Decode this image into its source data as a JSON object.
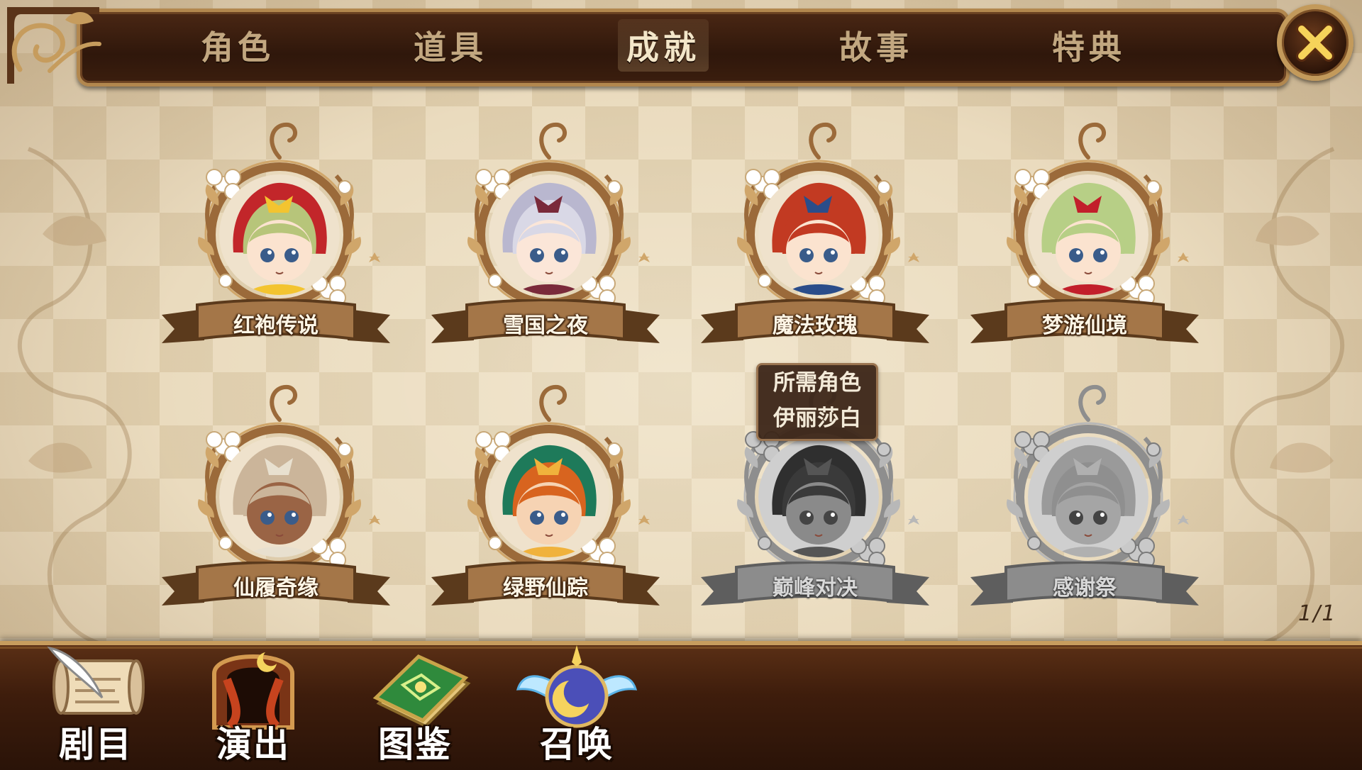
{
  "tabs": [
    {
      "label": "角色",
      "active": false
    },
    {
      "label": "道具",
      "active": false
    },
    {
      "label": "成就",
      "active": true
    },
    {
      "label": "故事",
      "active": false
    },
    {
      "label": "特典",
      "active": false
    }
  ],
  "close_icon": "close-x-icon",
  "cards": [
    {
      "title": "红袍传说",
      "locked": false,
      "hair": "#b7c57a",
      "hood": "#c2262a",
      "accent": "#f3c430",
      "skin": "#fbe3cf"
    },
    {
      "title": "雪国之夜",
      "locked": false,
      "hair": "#d9d8e6",
      "hood": "#b9b7cf",
      "accent": "#7a2a3a",
      "skin": "#fbe6d8"
    },
    {
      "title": "魔法玫瑰",
      "locked": false,
      "hair": "#c23a22",
      "hood": "#c23a22",
      "accent": "#2a4d8a",
      "skin": "#fbe3cf"
    },
    {
      "title": "梦游仙境",
      "locked": false,
      "hair": "#b7cf86",
      "hood": "#b7cf86",
      "accent": "#c21f2b",
      "skin": "#fbe3cf"
    },
    {
      "title": "仙履奇缘",
      "locked": false,
      "hair": "#cbb59a",
      "hood": "#cbb59a",
      "accent": "#e8e0cf",
      "skin": "#9a6445"
    },
    {
      "title": "绿野仙踪",
      "locked": false,
      "hair": "#d8641f",
      "hood": "#1e7a5a",
      "accent": "#f0b23c",
      "skin": "#f6d3b3"
    },
    {
      "title": "巅峰对决",
      "locked": true,
      "hair": "#3a3a3a",
      "hood": "#2f2f2f",
      "accent": "#555555",
      "skin": "#8a8a8a"
    },
    {
      "title": "感谢祭",
      "locked": true,
      "hair": "#8f8f8f",
      "hood": "#9a9a9a",
      "accent": "#b0b0b0",
      "skin": "#a5a5a5"
    }
  ],
  "tooltip": {
    "line1": "所需角色",
    "line2": "伊丽莎白"
  },
  "pager": "1/1",
  "bottom_nav": [
    {
      "label": "剧目",
      "icon": "scroll-quill-icon"
    },
    {
      "label": "演出",
      "icon": "stage-curtain-icon"
    },
    {
      "label": "图鉴",
      "icon": "green-book-icon"
    },
    {
      "label": "召唤",
      "icon": "winged-moon-orb-icon"
    }
  ],
  "colors": {
    "frame_gold": "#c39a5b",
    "bar_brown": "#3e1d0c",
    "board": "#eadbbe"
  }
}
